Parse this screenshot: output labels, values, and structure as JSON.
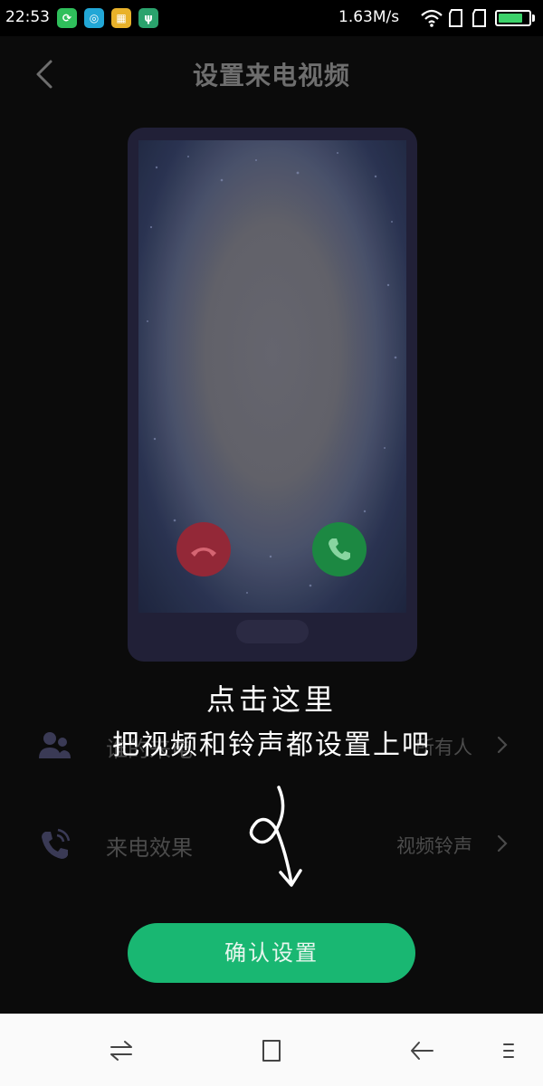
{
  "status_bar": {
    "time": "22:53",
    "network_speed": "1.63M/s",
    "battery_level_percent": 80,
    "notification_icons": [
      "sync-app-icon",
      "messenger-app-icon",
      "gallery-app-icon",
      "usb-icon"
    ],
    "status_icons": [
      "wifi-icon",
      "sim1-signal-icon",
      "sim2-signal-icon",
      "battery-icon"
    ],
    "colors": {
      "accent_green": "#3cd26a"
    }
  },
  "header": {
    "title": "设置来电视频",
    "back_icon": "chevron-left-icon"
  },
  "preview": {
    "decline_icon": "hang-up-icon",
    "accept_icon": "phone-icon",
    "colors": {
      "decline": "#9b2a3a",
      "accept": "#1d8f45"
    }
  },
  "annotation": {
    "line1": "点击这里",
    "line2": "把视频和铃声都设置上吧"
  },
  "settings": {
    "rows": [
      {
        "label": "谁的来电",
        "value": "所有人",
        "icon": "contacts-icon"
      },
      {
        "label": "来电效果",
        "value": "视频铃声",
        "icon": "call-effect-icon"
      }
    ]
  },
  "confirm_button": {
    "label": "确认设置",
    "color": "#19b772"
  },
  "nav_bar": {
    "buttons": [
      "menu-icon",
      "home-icon",
      "back-icon",
      "more-icon"
    ]
  }
}
